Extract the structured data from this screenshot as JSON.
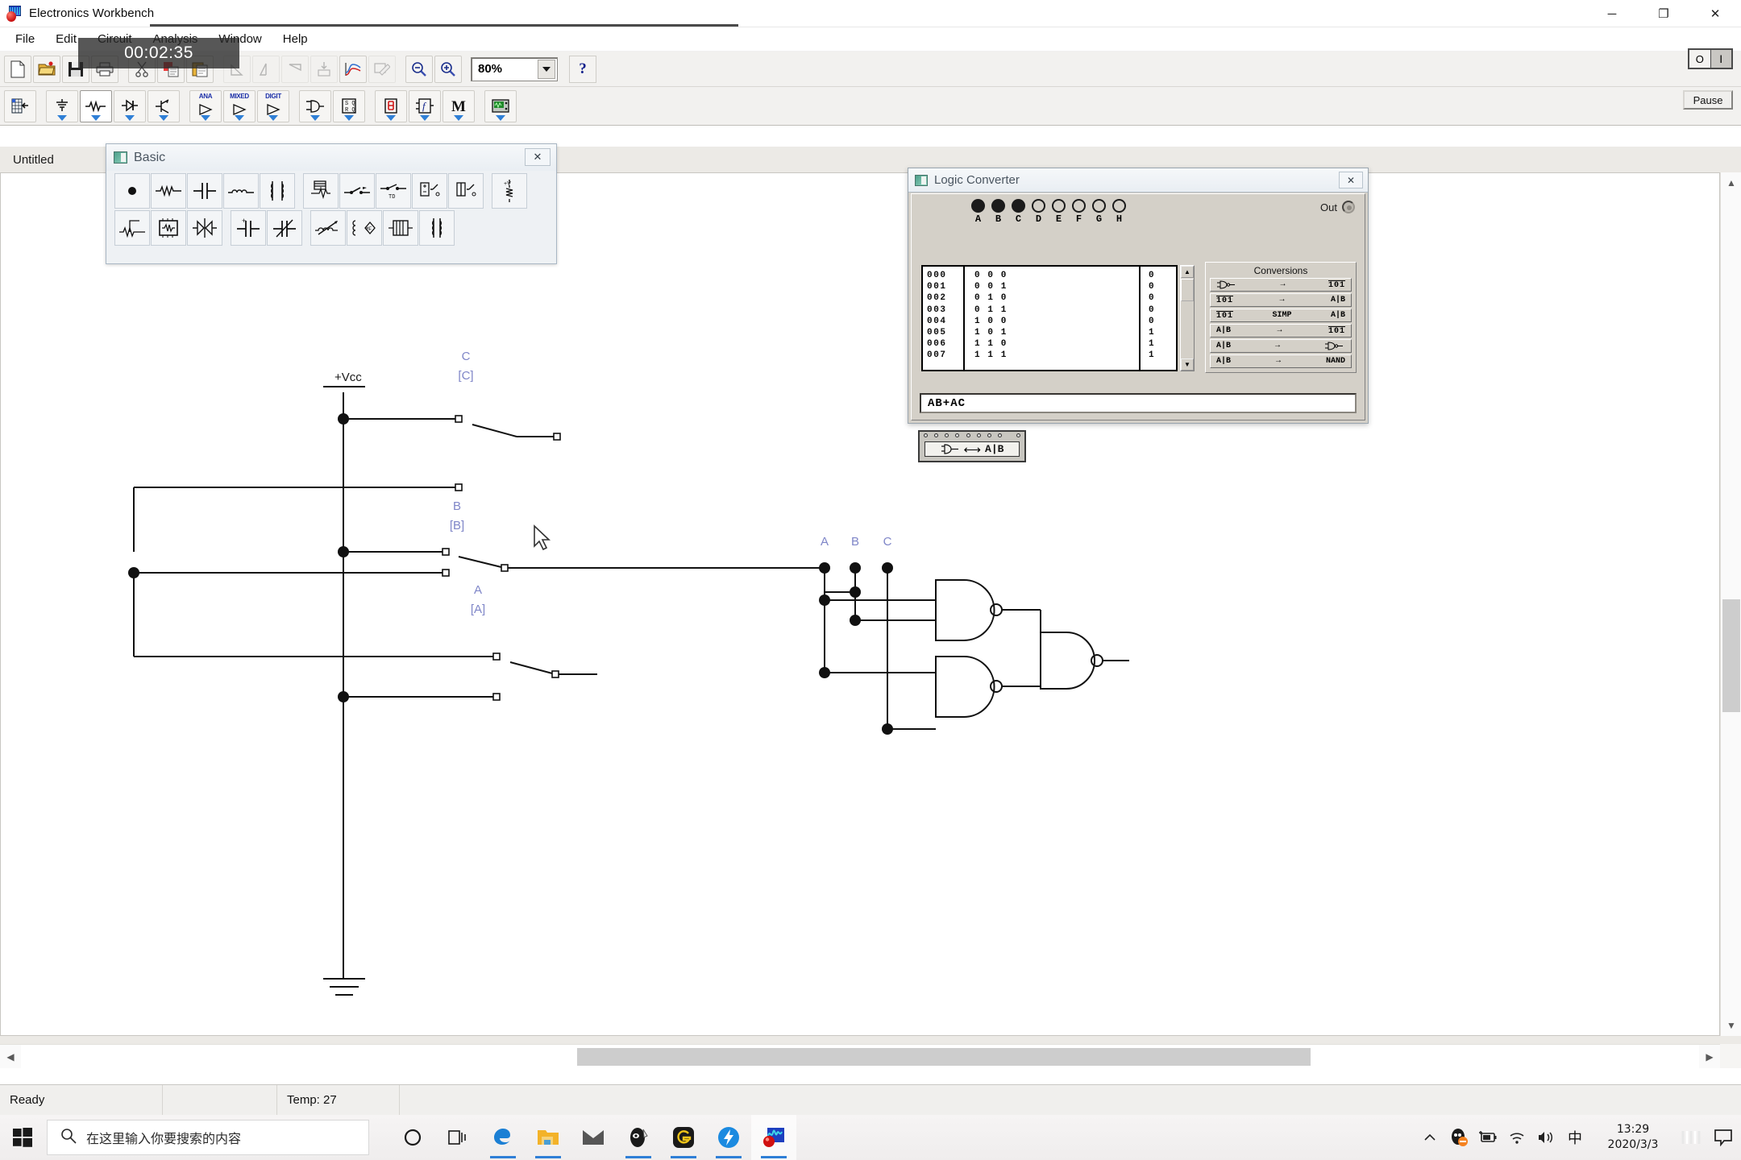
{
  "window": {
    "app_title": "Electronics Workbench",
    "app_icon": "ewb-logo-icon",
    "minimize": "─",
    "maximize": "❐",
    "close": "✕"
  },
  "menubar": {
    "items": [
      {
        "label": "File"
      },
      {
        "label": "Edit"
      },
      {
        "label": "Circuit"
      },
      {
        "label": "Analysis"
      },
      {
        "label": "Window"
      },
      {
        "label": "Help"
      }
    ]
  },
  "timer_overlay": {
    "value": "00:02:35"
  },
  "toolbar": {
    "zoom_value": "80%",
    "help_label": "?",
    "pause_label": "Pause",
    "power_off_label": "O",
    "power_on_label": "I",
    "buttons": [
      {
        "name": "new-file-button"
      },
      {
        "name": "open-file-button"
      },
      {
        "name": "save-file-button"
      },
      {
        "name": "print-button"
      },
      {
        "name": "cut-button"
      },
      {
        "name": "copy-button"
      },
      {
        "name": "paste-button"
      },
      {
        "name": "rotate-button"
      },
      {
        "name": "flip-horizontal-button"
      },
      {
        "name": "flip-vertical-button"
      },
      {
        "name": "create-subcircuit-button"
      },
      {
        "name": "display-graphs-button"
      },
      {
        "name": "component-properties-button"
      },
      {
        "name": "zoom-out-button"
      },
      {
        "name": "zoom-in-button"
      }
    ],
    "categories": [
      {
        "name": "favorites-parts-bin",
        "label": ""
      },
      {
        "name": "sources-parts-bin",
        "label": ""
      },
      {
        "name": "basic-parts-bin",
        "label": ""
      },
      {
        "name": "diodes-parts-bin",
        "label": ""
      },
      {
        "name": "transistors-parts-bin",
        "label": ""
      },
      {
        "name": "analog-ics-parts-bin",
        "label": "ANA"
      },
      {
        "name": "mixed-ics-parts-bin",
        "label": "MIXED"
      },
      {
        "name": "digital-ics-parts-bin",
        "label": "DIGIT"
      },
      {
        "name": "logic-gates-parts-bin",
        "label": ""
      },
      {
        "name": "digital-parts-bin",
        "label": ""
      },
      {
        "name": "indicators-parts-bin",
        "label": ""
      },
      {
        "name": "controls-parts-bin",
        "label": ""
      },
      {
        "name": "miscellaneous-parts-bin",
        "label": ""
      },
      {
        "name": "instruments-parts-bin",
        "label": ""
      }
    ]
  },
  "document": {
    "tab_label": "Untitled"
  },
  "basic_palette": {
    "title": "Basic",
    "close_label": "✕",
    "row1": [
      {
        "name": "connector-part"
      },
      {
        "name": "resistor-part"
      },
      {
        "name": "capacitor-part"
      },
      {
        "name": "inductor-part"
      },
      {
        "name": "transformer-part"
      },
      {
        "name": "relay-part"
      },
      {
        "name": "switch-part"
      },
      {
        "name": "time-delay-switch-part"
      },
      {
        "name": "voltage-controlled-switch-part"
      },
      {
        "name": "current-controlled-switch-part"
      },
      {
        "name": "pullup-resistor-part"
      }
    ],
    "row2": [
      {
        "name": "potentiometer-part"
      },
      {
        "name": "resistor-pack-part"
      },
      {
        "name": "variable-capacitor-part"
      },
      {
        "name": "polarized-capacitor-part"
      },
      {
        "name": "variable-inductor-part"
      },
      {
        "name": "nonlinear-transformer-part"
      },
      {
        "name": "magnetic-core-part"
      },
      {
        "name": "coreless-coil-part"
      },
      {
        "name": "coupled-inductors-part"
      }
    ]
  },
  "logic_converter": {
    "title": "Logic Converter",
    "close_label": "✕",
    "out_label": "Out",
    "terminals": [
      {
        "letter": "A",
        "active": true
      },
      {
        "letter": "B",
        "active": true
      },
      {
        "letter": "C",
        "active": true
      },
      {
        "letter": "D",
        "active": false
      },
      {
        "letter": "E",
        "active": false
      },
      {
        "letter": "F",
        "active": false
      },
      {
        "letter": "G",
        "active": false
      },
      {
        "letter": "H",
        "active": false
      }
    ],
    "truth_table": {
      "index": [
        "000",
        "001",
        "002",
        "003",
        "004",
        "005",
        "006",
        "007"
      ],
      "inputs": [
        "0 0 0",
        "0 0 1",
        "0 1 0",
        "0 1 1",
        "1 0 0",
        "1 0 1",
        "1 1 0",
        "1 1 1"
      ],
      "output": [
        "0",
        "0",
        "0",
        "0",
        "0",
        "1",
        "1",
        "1"
      ]
    },
    "conversions_title": "Conversions",
    "conversions": [
      {
        "name": "circuit-to-truth-table",
        "left": "gate",
        "mid": "→",
        "right": "101"
      },
      {
        "name": "truth-table-to-expression",
        "left": "101",
        "mid": "→",
        "right": "A|B"
      },
      {
        "name": "truth-table-to-simplified-expression",
        "left": "101",
        "mid": "SIMP",
        "right": "A|B"
      },
      {
        "name": "expression-to-truth-table",
        "left": "A|B",
        "mid": "→",
        "right": "101"
      },
      {
        "name": "expression-to-circuit",
        "left": "A|B",
        "mid": "→",
        "right": "gate"
      },
      {
        "name": "expression-to-nand",
        "left": "A|B",
        "mid": "→",
        "right": "NAND"
      }
    ],
    "expression": "AB+AC"
  },
  "circuit": {
    "vcc_label": "+Vcc",
    "switches": [
      {
        "name": "switch-c",
        "label": "C",
        "key": "[C]"
      },
      {
        "name": "switch-b",
        "label": "B",
        "key": "[B]"
      },
      {
        "name": "switch-a",
        "label": "A",
        "key": "[A]"
      }
    ],
    "node_labels": [
      "A",
      "B",
      "C"
    ],
    "gates": [
      {
        "name": "nand-gate-1"
      },
      {
        "name": "nand-gate-2"
      },
      {
        "name": "nand-gate-3"
      }
    ],
    "logic_converter_component": {
      "name": "logic-converter-component",
      "left_symbol": "gate",
      "arrow": "⟷",
      "right_symbol": "A|B"
    }
  },
  "statusbar": {
    "status": "Ready",
    "middle": "",
    "temp": "Temp: 27",
    "right": ""
  },
  "taskbar": {
    "start": "windows-logo-icon",
    "search_placeholder": "在这里输入你要搜索的内容",
    "items": [
      {
        "name": "cortana-icon",
        "running": false
      },
      {
        "name": "task-view-icon",
        "running": false
      },
      {
        "name": "microsoft-edge-icon",
        "running": true
      },
      {
        "name": "file-explorer-icon",
        "running": true
      },
      {
        "name": "mail-icon",
        "running": false
      },
      {
        "name": "ninja-app-icon",
        "running": true
      },
      {
        "name": "camtasia-icon",
        "running": true
      },
      {
        "name": "bandizip-icon",
        "running": true
      },
      {
        "name": "electronics-workbench-icon",
        "running": true
      }
    ],
    "tray": [
      {
        "name": "show-hidden-icons-chevron"
      },
      {
        "name": "qq-icon"
      },
      {
        "name": "battery-icon"
      },
      {
        "name": "wifi-icon"
      },
      {
        "name": "volume-icon"
      },
      {
        "name": "ime-chinese-icon",
        "label": "中"
      }
    ],
    "clock_time": "13:29",
    "clock_date": "2020/3/3",
    "overflow_icon": "ime-panel-icon",
    "notifications_icon": "action-center-icon"
  },
  "colors": {
    "accent": "#2f7fd6",
    "label_blue": "#7f86c8",
    "window_face": "#d4d0c8",
    "toolbar_bg": "#f2f1ef"
  }
}
